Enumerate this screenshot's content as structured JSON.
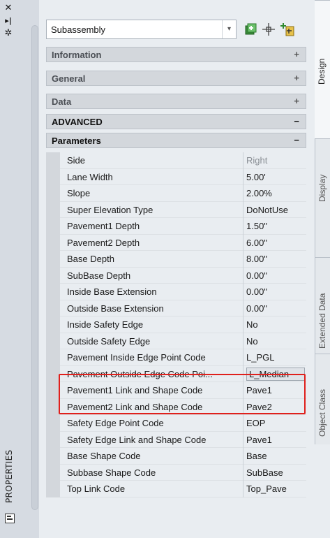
{
  "palette": {
    "window_bg": "#d6dbe2",
    "panel_bg": "#e9edf1",
    "section_header_bg": "#d3d7dc",
    "highlight_border": "#e0201c",
    "dim_text": "#8a8f95"
  },
  "left_strip": {
    "close_icon": "close-icon",
    "autohide_icon": "autohide-icon",
    "properties_icon": "properties-settings-icon",
    "title": "PROPERTIES",
    "palette_icon": "palette-icon"
  },
  "toolbar": {
    "selector_value": "Subassembly",
    "quick_select_icon": "quick-select-icon",
    "select_objects_icon": "select-objects-icon",
    "toggle_pickadd_icon": "toggle-pickadd-icon"
  },
  "sections": [
    {
      "label": "Information",
      "sign": "+"
    },
    {
      "label": "General",
      "sign": "+"
    },
    {
      "label": "Data",
      "sign": "+"
    },
    {
      "label": "ADVANCED",
      "sign": "−"
    },
    {
      "label": "Parameters",
      "sign": "−"
    }
  ],
  "parameters": [
    {
      "name": "Side",
      "value": "Right",
      "dim": true
    },
    {
      "name": "Lane Width",
      "value": "5.00'"
    },
    {
      "name": "Slope",
      "value": "2.00%"
    },
    {
      "name": "Super Elevation Type",
      "value": "DoNotUse"
    },
    {
      "name": "Pavement1 Depth",
      "value": "1.50\""
    },
    {
      "name": "Pavement2 Depth",
      "value": "6.00\""
    },
    {
      "name": "Base Depth",
      "value": "8.00\""
    },
    {
      "name": "SubBase Depth",
      "value": "0.00\""
    },
    {
      "name": "Inside Base Extension",
      "value": "0.00\""
    },
    {
      "name": "Outside Base Extension",
      "value": "0.00\""
    },
    {
      "name": "Inside Safety Edge",
      "value": "No"
    },
    {
      "name": "Outside Safety Edge",
      "value": "No"
    },
    {
      "name": "Pavement Inside Edge Point Code",
      "value": "L_PGL"
    },
    {
      "name": "Pavement Outside Edge Code Poi...",
      "value": "L_Median",
      "selected": true
    },
    {
      "name": "Pavement1 Link and Shape Code",
      "value": "Pave1"
    },
    {
      "name": "Pavement2 Link and Shape Code",
      "value": "Pave2"
    },
    {
      "name": "Safety Edge Point Code",
      "value": "EOP"
    },
    {
      "name": "Safety Edge Link and Shape Code",
      "value": "Pave1"
    },
    {
      "name": "Base Shape Code",
      "value": "Base"
    },
    {
      "name": "Subbase Shape Code",
      "value": "SubBase"
    },
    {
      "name": "Top Link Code",
      "value": "Top_Pave"
    }
  ],
  "right_tabs": [
    {
      "label": "Design",
      "active": true
    },
    {
      "label": "Display"
    },
    {
      "label": "Extended Data"
    },
    {
      "label": "Object Class"
    }
  ]
}
